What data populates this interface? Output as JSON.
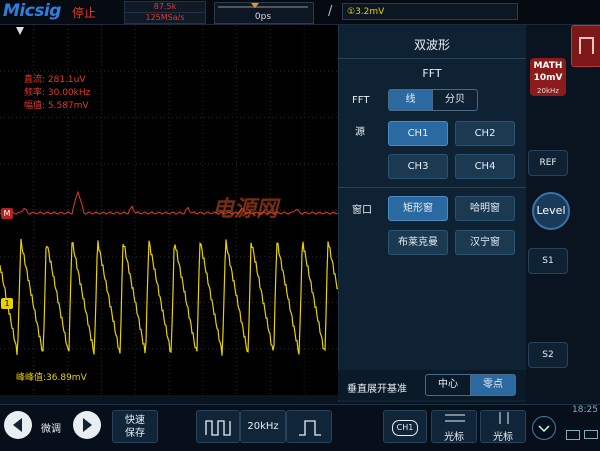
{
  "topbar": {
    "logo": "Micsig",
    "status": "停止",
    "sample_points": "87.5k",
    "sample_rate": "125MSa/s",
    "time_offset": "0ps",
    "slope_icon": "rising-edge-icon",
    "trigger_level": "①3.2mV"
  },
  "screen": {
    "measurements": {
      "mean": "直流: 281.1uV",
      "frequency": "频率: 30.00kHz",
      "amplitude": "幅值: 5.587mV"
    },
    "peak_to_peak": "峰峰值:36.89mV",
    "math_marker": "M",
    "ch1_marker": "1"
  },
  "panel": {
    "title": "双波形",
    "fft_label": "FFT",
    "fft_row_label": "FFT",
    "fft_modes": [
      "线",
      "分贝"
    ],
    "fft_mode_selected": 0,
    "source_label": "源",
    "sources": [
      "CH1",
      "CH2",
      "CH3",
      "CH4"
    ],
    "source_selected": 0,
    "window_label": "窗口",
    "windows": [
      "矩形窗",
      "哈明窗",
      "布莱克曼",
      "汉宁窗"
    ],
    "window_selected": 0,
    "vertical_label": "垂直展开基准",
    "vertical_options": [
      "中心",
      "零点"
    ],
    "vertical_selected": 1
  },
  "right": {
    "math_title": "MATH",
    "math_scale": "10mV",
    "math_freq": "20kHz",
    "ref": "REF",
    "level": "Level",
    "s1": "S1",
    "s2": "S2"
  },
  "bottom": {
    "fine_label": "微调",
    "quick_save": "快速保存",
    "freq": "20kHz",
    "ch1_chip": "CH1",
    "cursor_h": "光标",
    "cursor_v": "光标",
    "time": "18:25"
  },
  "watermark": "电源网",
  "colors": {
    "ch1": "#e8d200",
    "math": "#e23a2e",
    "accent": "#2b6aa0",
    "panel_bg": "#0f2233"
  }
}
